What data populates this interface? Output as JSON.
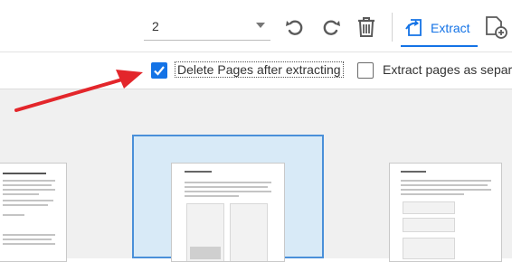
{
  "toolbar": {
    "page_value": "2",
    "extract_label": "Extract",
    "accent_color": "#1473e6",
    "icons": [
      "undo-icon",
      "redo-icon",
      "trash-icon",
      "extract-icon",
      "insert-page-icon"
    ]
  },
  "options": {
    "delete_pages": {
      "label": "Delete Pages after extracting",
      "checked": true
    },
    "extract_separate": {
      "label": "Extract pages as separa",
      "checked": false
    }
  },
  "annotation": {
    "arrow_color": "#e3262b"
  }
}
